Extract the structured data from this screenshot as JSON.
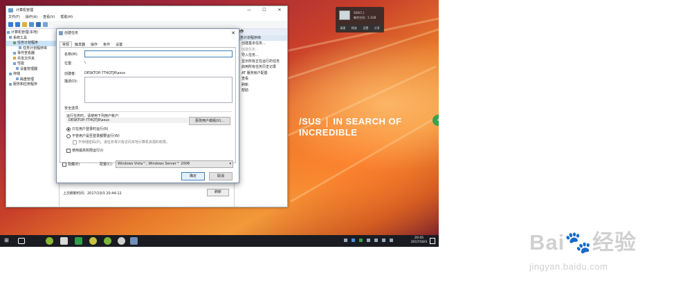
{
  "desktop": {
    "brand_logo": "/SUS",
    "brand_slogan": "IN SEARCH OF INCREDIBLE",
    "ssd_widget": {
      "title": "SSD(C:)",
      "usage": "剩余空间：3.1GB",
      "actions": [
        "清理",
        "释放",
        "设置",
        "分享"
      ]
    }
  },
  "mmc": {
    "title": "计算机管理",
    "menu": [
      "文件(F)",
      "操作(A)",
      "查看(V)",
      "帮助(H)"
    ],
    "tree": [
      "计算机管理(本地)",
      "系统工具",
      "任务计划程序",
      "任务计划程序库",
      "事件查看器",
      "共享文件夹",
      "性能",
      "设备管理器",
      "存储",
      "磁盘管理",
      "服务和应用程序"
    ],
    "actions_header": "操作",
    "actions_sub": "任务计划程序库",
    "actions": [
      "创建基本任务...",
      "创建任务...",
      "导入任务...",
      "显示所有正在运行的任务",
      "启用所有任务历史记录",
      "AT 服务帐户配置",
      "查看",
      "刷新",
      "帮助"
    ],
    "last_refresh": "上次刷新时间：2017/10/3 20:44:12",
    "refresh_button": "刷新"
  },
  "dialog": {
    "title": "创建任务",
    "tabs": [
      "常规",
      "触发器",
      "操作",
      "条件",
      "设置"
    ],
    "name_label": "名称(M):",
    "name_value": "",
    "location_label": "位置:",
    "location_value": "\\",
    "author_label": "创建者:",
    "author_value": "DESKTOP-7T4QTJ8\\asus",
    "desc_label": "描述(D):",
    "security_title": "安全选项",
    "run_as_text": "运行任务时，请使用下列用户帐户:",
    "run_as_user": "DESKTOP-7T4QTJ8\\asus",
    "change_user_button": "更改用户或组(U)...",
    "radio_logged_on": "只在用户登录时运行(R)",
    "radio_whether": "不管用户是否登录都要运行(W)",
    "no_store_password": "不存储密码(P)。该任务将只有访问本地计算机资源的权限。",
    "highest_priv": "使用最高权限运行(I)",
    "hidden_label": "隐藏(E)",
    "config_label": "配置(C):",
    "config_value": "Windows Vista™, Windows Server™ 2008",
    "ok_button": "确定",
    "cancel_button": "取消"
  },
  "taskbar": {
    "time": "20:45",
    "date": "2017/10/3"
  },
  "watermark": {
    "logo": "Bai🐾经验",
    "url": "jingyan.baidu.com"
  }
}
